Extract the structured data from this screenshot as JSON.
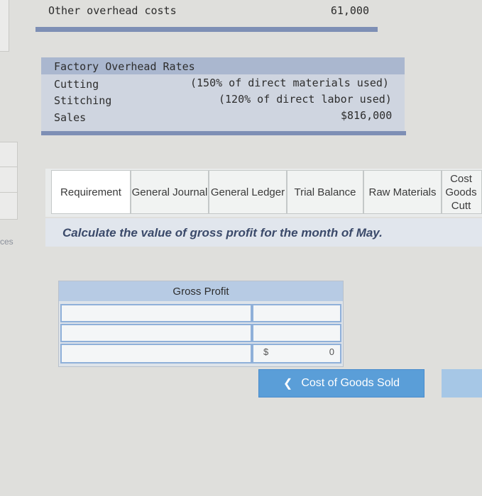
{
  "overhead": {
    "label": "Other overhead costs",
    "amount": "61,000"
  },
  "rates": {
    "title": "Factory Overhead Rates",
    "cutting_label": "Cutting",
    "cutting_rate": "(150% of direct materials used)",
    "stitching_label": "Stitching",
    "stitching_rate": "(120% of direct labor used)",
    "sales_label": "Sales",
    "sales_amount": "$816,000"
  },
  "tabs": [
    {
      "label": "Requirement"
    },
    {
      "label": "General Journal"
    },
    {
      "label": "General Ledger"
    },
    {
      "label": "Trial Balance"
    },
    {
      "label": "Raw Materials"
    },
    {
      "label": "Cost Goods Cutt"
    }
  ],
  "left_edge_text": "ces",
  "instruction": "Calculate the value of gross profit for the month of May.",
  "gross_profit": {
    "header": "Gross Profit",
    "currency": "$",
    "total_value": "0"
  },
  "nav": {
    "prev_label": "Cost of Goods Sold"
  },
  "colors": {
    "accent": "#5a9ed8",
    "header_blue": "#b7cbe4",
    "instruction": "#3b4a6a"
  }
}
